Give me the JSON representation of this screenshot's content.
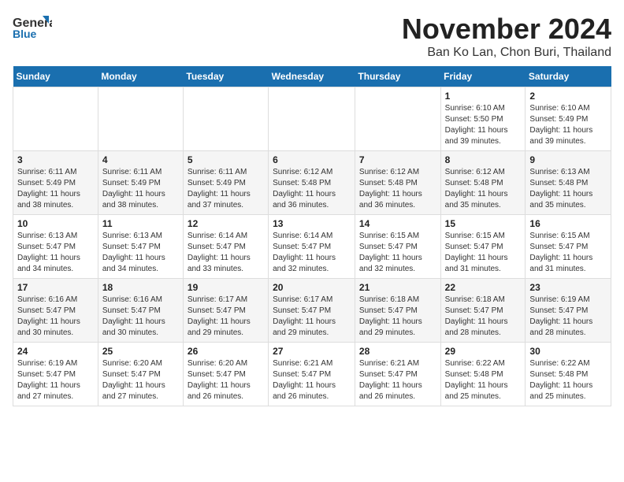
{
  "logo": {
    "line1": "General",
    "line2": "Blue"
  },
  "header": {
    "month": "November 2024",
    "location": "Ban Ko Lan, Chon Buri, Thailand"
  },
  "weekdays": [
    "Sunday",
    "Monday",
    "Tuesday",
    "Wednesday",
    "Thursday",
    "Friday",
    "Saturday"
  ],
  "weeks": [
    [
      {
        "day": "",
        "info": ""
      },
      {
        "day": "",
        "info": ""
      },
      {
        "day": "",
        "info": ""
      },
      {
        "day": "",
        "info": ""
      },
      {
        "day": "",
        "info": ""
      },
      {
        "day": "1",
        "info": "Sunrise: 6:10 AM\nSunset: 5:50 PM\nDaylight: 11 hours and 39 minutes."
      },
      {
        "day": "2",
        "info": "Sunrise: 6:10 AM\nSunset: 5:49 PM\nDaylight: 11 hours and 39 minutes."
      }
    ],
    [
      {
        "day": "3",
        "info": "Sunrise: 6:11 AM\nSunset: 5:49 PM\nDaylight: 11 hours and 38 minutes."
      },
      {
        "day": "4",
        "info": "Sunrise: 6:11 AM\nSunset: 5:49 PM\nDaylight: 11 hours and 38 minutes."
      },
      {
        "day": "5",
        "info": "Sunrise: 6:11 AM\nSunset: 5:49 PM\nDaylight: 11 hours and 37 minutes."
      },
      {
        "day": "6",
        "info": "Sunrise: 6:12 AM\nSunset: 5:48 PM\nDaylight: 11 hours and 36 minutes."
      },
      {
        "day": "7",
        "info": "Sunrise: 6:12 AM\nSunset: 5:48 PM\nDaylight: 11 hours and 36 minutes."
      },
      {
        "day": "8",
        "info": "Sunrise: 6:12 AM\nSunset: 5:48 PM\nDaylight: 11 hours and 35 minutes."
      },
      {
        "day": "9",
        "info": "Sunrise: 6:13 AM\nSunset: 5:48 PM\nDaylight: 11 hours and 35 minutes."
      }
    ],
    [
      {
        "day": "10",
        "info": "Sunrise: 6:13 AM\nSunset: 5:47 PM\nDaylight: 11 hours and 34 minutes."
      },
      {
        "day": "11",
        "info": "Sunrise: 6:13 AM\nSunset: 5:47 PM\nDaylight: 11 hours and 34 minutes."
      },
      {
        "day": "12",
        "info": "Sunrise: 6:14 AM\nSunset: 5:47 PM\nDaylight: 11 hours and 33 minutes."
      },
      {
        "day": "13",
        "info": "Sunrise: 6:14 AM\nSunset: 5:47 PM\nDaylight: 11 hours and 32 minutes."
      },
      {
        "day": "14",
        "info": "Sunrise: 6:15 AM\nSunset: 5:47 PM\nDaylight: 11 hours and 32 minutes."
      },
      {
        "day": "15",
        "info": "Sunrise: 6:15 AM\nSunset: 5:47 PM\nDaylight: 11 hours and 31 minutes."
      },
      {
        "day": "16",
        "info": "Sunrise: 6:15 AM\nSunset: 5:47 PM\nDaylight: 11 hours and 31 minutes."
      }
    ],
    [
      {
        "day": "17",
        "info": "Sunrise: 6:16 AM\nSunset: 5:47 PM\nDaylight: 11 hours and 30 minutes."
      },
      {
        "day": "18",
        "info": "Sunrise: 6:16 AM\nSunset: 5:47 PM\nDaylight: 11 hours and 30 minutes."
      },
      {
        "day": "19",
        "info": "Sunrise: 6:17 AM\nSunset: 5:47 PM\nDaylight: 11 hours and 29 minutes."
      },
      {
        "day": "20",
        "info": "Sunrise: 6:17 AM\nSunset: 5:47 PM\nDaylight: 11 hours and 29 minutes."
      },
      {
        "day": "21",
        "info": "Sunrise: 6:18 AM\nSunset: 5:47 PM\nDaylight: 11 hours and 29 minutes."
      },
      {
        "day": "22",
        "info": "Sunrise: 6:18 AM\nSunset: 5:47 PM\nDaylight: 11 hours and 28 minutes."
      },
      {
        "day": "23",
        "info": "Sunrise: 6:19 AM\nSunset: 5:47 PM\nDaylight: 11 hours and 28 minutes."
      }
    ],
    [
      {
        "day": "24",
        "info": "Sunrise: 6:19 AM\nSunset: 5:47 PM\nDaylight: 11 hours and 27 minutes."
      },
      {
        "day": "25",
        "info": "Sunrise: 6:20 AM\nSunset: 5:47 PM\nDaylight: 11 hours and 27 minutes."
      },
      {
        "day": "26",
        "info": "Sunrise: 6:20 AM\nSunset: 5:47 PM\nDaylight: 11 hours and 26 minutes."
      },
      {
        "day": "27",
        "info": "Sunrise: 6:21 AM\nSunset: 5:47 PM\nDaylight: 11 hours and 26 minutes."
      },
      {
        "day": "28",
        "info": "Sunrise: 6:21 AM\nSunset: 5:47 PM\nDaylight: 11 hours and 26 minutes."
      },
      {
        "day": "29",
        "info": "Sunrise: 6:22 AM\nSunset: 5:48 PM\nDaylight: 11 hours and 25 minutes."
      },
      {
        "day": "30",
        "info": "Sunrise: 6:22 AM\nSunset: 5:48 PM\nDaylight: 11 hours and 25 minutes."
      }
    ]
  ]
}
